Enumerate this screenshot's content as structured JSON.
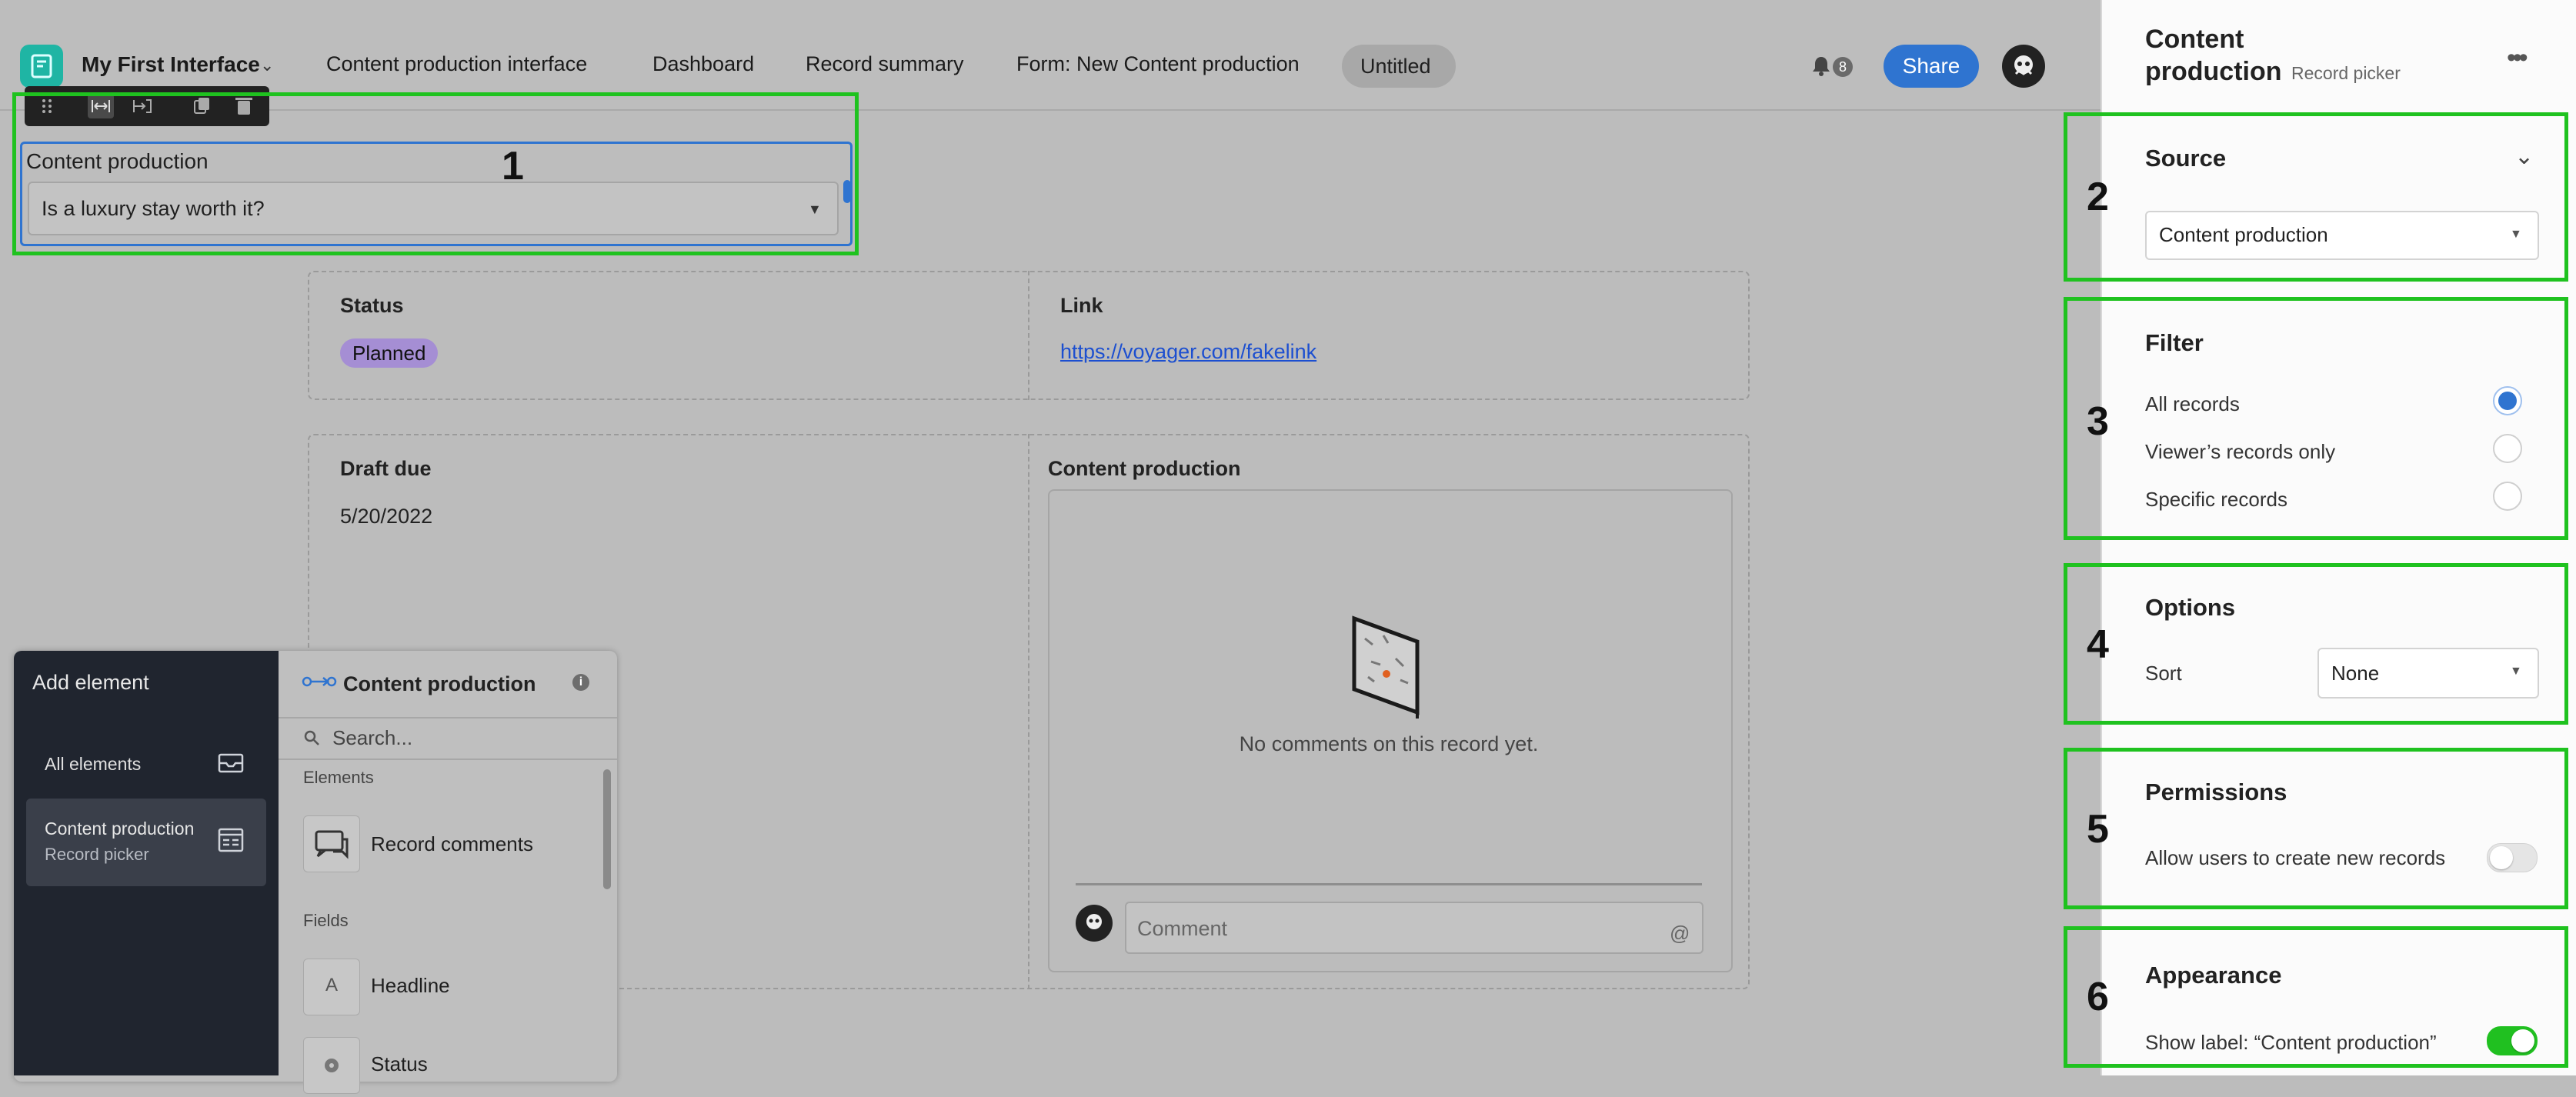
{
  "topbar": {
    "app_name": "My First Interface",
    "tabs": [
      "Content production interface",
      "Dashboard",
      "Record summary",
      "Form: New Content production",
      "Untitled"
    ],
    "notification_count": "8",
    "share_label": "Share"
  },
  "record_picker": {
    "label": "Content production",
    "value": "Is a luxury stay worth it?"
  },
  "annotations": [
    "1",
    "2",
    "3",
    "4",
    "5",
    "6"
  ],
  "record": {
    "status_label": "Status",
    "status_value": "Planned",
    "link_label": "Link",
    "link_value": "https://voyager.com/fakelink",
    "draft_due_label": "Draft due",
    "draft_due_value": "5/20/2022",
    "comments_label": "Content production",
    "no_comments": "No comments on this record yet.",
    "comment_placeholder": "Comment",
    "comment_at": "@"
  },
  "add_element": {
    "title": "Add element",
    "all_elements": "All elements",
    "selected_title": "Content production",
    "selected_subtitle": "Record picker",
    "panel_title": "Content production",
    "search_placeholder": "Search...",
    "section_elements": "Elements",
    "item_comments": "Record comments",
    "section_fields": "Fields",
    "item_headline": "Headline",
    "item_headline_glyph": "A",
    "item_status": "Status"
  },
  "properties": {
    "title_line1": "Content",
    "title_line2": "production",
    "subtitle": "Record picker",
    "source_title": "Source",
    "source_value": "Content production",
    "filter_title": "Filter",
    "filter_options": [
      "All records",
      "Viewer’s records only",
      "Specific records"
    ],
    "filter_selected": 0,
    "options_title": "Options",
    "sort_label": "Sort",
    "sort_value": "None",
    "permissions_title": "Permissions",
    "allow_create_label": "Allow users to create new records",
    "allow_create_on": false,
    "appearance_title": "Appearance",
    "show_label_label": "Show label: “Content production”",
    "show_label_on": true
  },
  "colors": {
    "accent": "#2f74d0",
    "highlight": "#1fc21f",
    "status_badge": "#a58ed4",
    "toggle_on": "#20c020",
    "logo": "#1fb5a4"
  }
}
